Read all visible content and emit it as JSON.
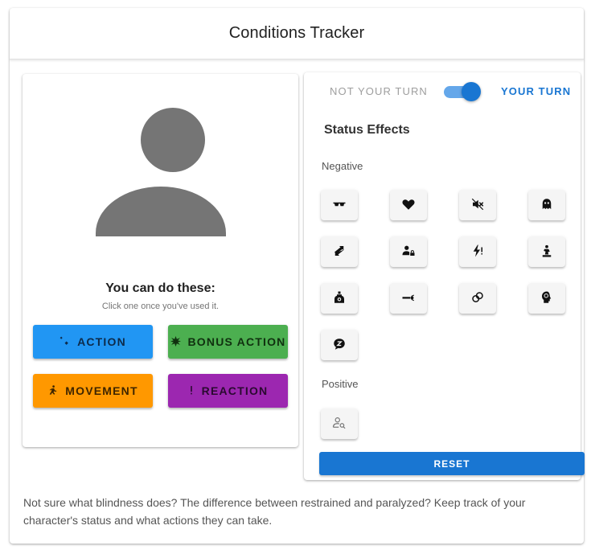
{
  "header": {
    "title": "Conditions Tracker"
  },
  "character": {
    "can_do_title": "You can do these:",
    "can_do_subtitle": "Click one once you've used it."
  },
  "actions": [
    {
      "label": "ACTION",
      "icon": "sword-icon",
      "glyph": "🗡",
      "color": "#2196f3"
    },
    {
      "label": "BONUS ACTION",
      "icon": "burst-icon",
      "glyph": "✸",
      "color": "#4caf50"
    },
    {
      "label": "MOVEMENT",
      "icon": "running-icon",
      "glyph": "🏃",
      "color": "#ff9800"
    },
    {
      "label": "REACTION",
      "icon": "exclamation-icon",
      "glyph": "!",
      "color": "#9c27b0"
    }
  ],
  "turn": {
    "not_your_turn": "NOT YOUR TURN",
    "your_turn": "YOUR TURN",
    "is_your_turn": true,
    "accent_color": "#1976d2"
  },
  "status_effects": {
    "title": "Status Effects",
    "negative_label": "Negative",
    "positive_label": "Positive",
    "negative": [
      {
        "name": "blinded",
        "icon": "sunglasses-icon"
      },
      {
        "name": "charmed",
        "icon": "heart-icon"
      },
      {
        "name": "deafened",
        "icon": "muted-speaker-icon"
      },
      {
        "name": "frightened",
        "icon": "ghost-icon"
      },
      {
        "name": "grappled",
        "icon": "swap-arrows-icon"
      },
      {
        "name": "incapacitated",
        "icon": "person-locked-icon"
      },
      {
        "name": "paralyzed",
        "icon": "lightning-exclaim-icon"
      },
      {
        "name": "petrified",
        "icon": "statue-icon"
      },
      {
        "name": "poisoned",
        "icon": "poison-bottle-icon"
      },
      {
        "name": "prone",
        "icon": "lying-person-icon"
      },
      {
        "name": "restrained",
        "icon": "shackles-icon"
      },
      {
        "name": "stunned",
        "icon": "dizzy-head-icon"
      },
      {
        "name": "unconscious",
        "icon": "sleep-bubble-icon"
      }
    ],
    "positive": [
      {
        "name": "invisible",
        "icon": "person-search-icon"
      }
    ]
  },
  "reset_label": "RESET",
  "footer": {
    "description": "Not sure what blindness does? The difference between restrained and paralyzed? Keep track of your character's status and what actions they can take."
  }
}
